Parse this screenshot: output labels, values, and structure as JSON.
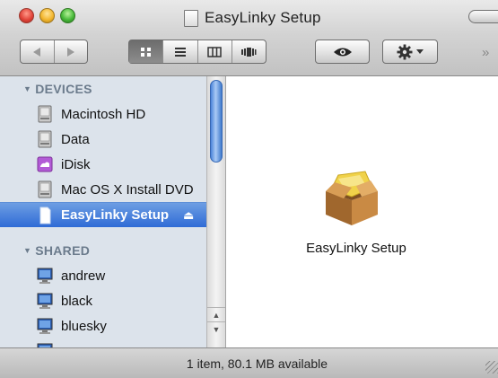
{
  "window": {
    "title": "EasyLinky Setup",
    "status": "1 item, 80.1 MB available"
  },
  "toolbar": {
    "back": "back",
    "forward": "forward",
    "views": [
      "icon-view",
      "list-view",
      "column-view",
      "cover-flow-view"
    ],
    "active_view": "icon-view",
    "quicklook": "eye-icon",
    "action": "gear-icon"
  },
  "sidebar": {
    "devices_header": "DEVICES",
    "devices": [
      {
        "label": "Macintosh HD",
        "icon": "hard-drive-icon"
      },
      {
        "label": "Data",
        "icon": "hard-drive-icon"
      },
      {
        "label": "iDisk",
        "icon": "idisk-icon"
      },
      {
        "label": "Mac OS X Install DVD",
        "icon": "dvd-drive-icon"
      },
      {
        "label": "EasyLinky Setup",
        "icon": "disk-image-icon",
        "selected": true
      }
    ],
    "eject": "⏏",
    "shared_header": "SHARED",
    "shared": [
      {
        "label": "andrew",
        "icon": "computer-icon"
      },
      {
        "label": "black",
        "icon": "computer-icon"
      },
      {
        "label": "bluesky",
        "icon": "computer-icon"
      }
    ]
  },
  "content": {
    "items": [
      {
        "label": "EasyLinky Setup",
        "icon": "package-icon"
      }
    ]
  }
}
